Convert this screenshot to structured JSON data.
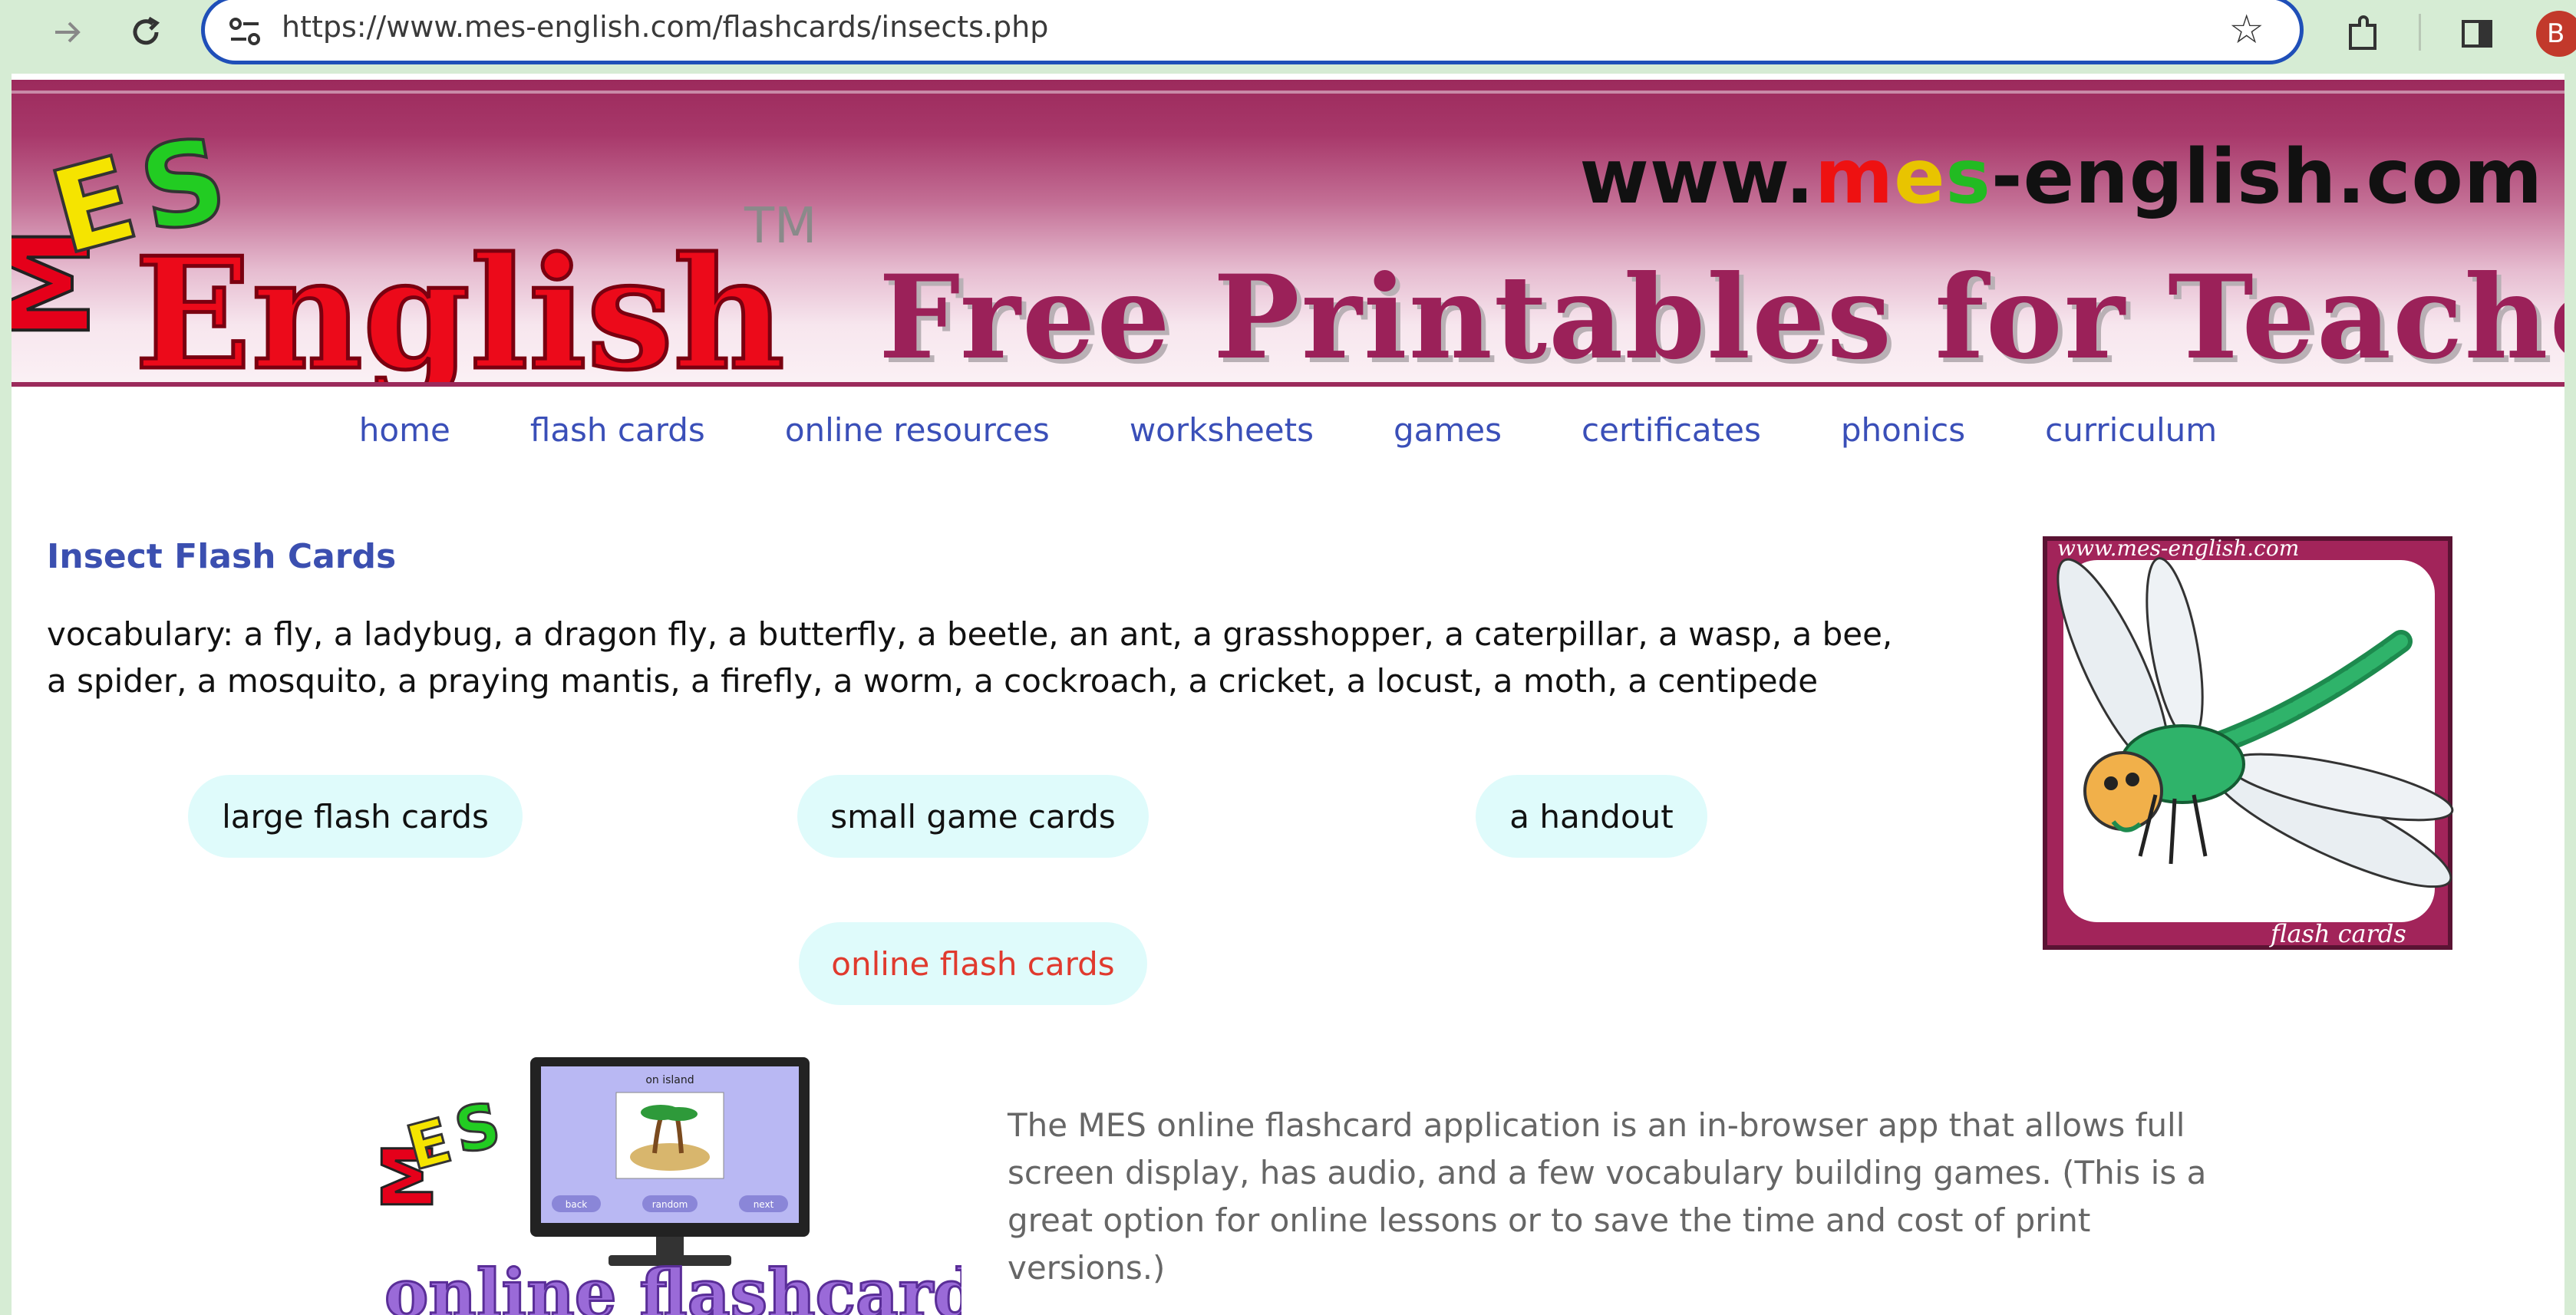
{
  "browser": {
    "url": "https://www.mes-english.com/flashcards/insects.php",
    "profile_initial": "B"
  },
  "banner": {
    "logo_mes": "MES",
    "logo_english": "English",
    "logo_tm": "TM",
    "site_parts": [
      "www.",
      "m",
      "e",
      "s",
      "-english.com"
    ],
    "tagline": "Free Printables for Teachers"
  },
  "menu": [
    "home",
    "flash cards",
    "online resources",
    "worksheets",
    "games",
    "certificates",
    "phonics",
    "curriculum"
  ],
  "main": {
    "title": "Insect Flash Cards",
    "vocab_line1": "vocabulary: a fly, a ladybug, a dragon fly, a butterfly, a beetle, an ant, a grasshopper, a caterpillar, a wasp, a bee,",
    "vocab_line2": "a spider, a mosquito, a praying mantis, a firefly, a worm, a cockroach, a cricket, a locust, a moth, a centipede",
    "buttons": {
      "large": "large flash cards",
      "small": "small game cards",
      "handout": "a handout",
      "online": "online flash cards"
    },
    "flashcard_image": {
      "site_text": "www.mes-english.com",
      "caption": "flash cards"
    },
    "app_image": {
      "screen_title": "on island",
      "btn_back": "back",
      "btn_random": "random",
      "btn_next": "next",
      "logo_text": "online flashcards"
    },
    "description": "The MES online flashcard application is an in-browser app that allows full screen display, has audio, and a few vocabulary building games. (This is a great option for online lessons or to save the time and cost of print versions.)"
  },
  "colors": {
    "link": "#3a4fb8",
    "banner_magenta": "#9b2159",
    "pill_bg": "#dffbfb",
    "online_red": "#e03a2e"
  }
}
